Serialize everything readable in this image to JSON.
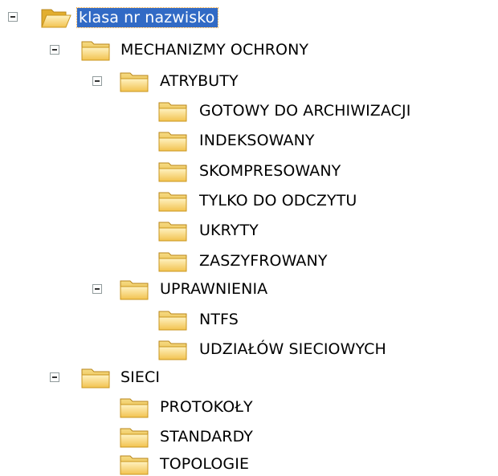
{
  "tree": {
    "root": {
      "label": "klasa nr nazwisko",
      "icon": "folder-open-icon",
      "expanded": true,
      "selected": true
    },
    "mechanizmy": {
      "label": "MECHANIZMY OCHRONY",
      "icon": "folder-open-icon",
      "expanded": true
    },
    "atrybuty": {
      "label": "ATRYBUTY",
      "icon": "folder-open-icon",
      "expanded": true
    },
    "atrybuty_children": [
      {
        "label": "GOTOWY DO ARCHIWIZACJI",
        "icon": "folder-closed-icon"
      },
      {
        "label": "INDEKSOWANY",
        "icon": "folder-closed-icon"
      },
      {
        "label": "SKOMPRESOWANY",
        "icon": "folder-closed-icon"
      },
      {
        "label": "TYLKO DO ODCZYTU",
        "icon": "folder-closed-icon"
      },
      {
        "label": "UKRYTY",
        "icon": "folder-closed-icon"
      },
      {
        "label": "ZASZYFROWANY",
        "icon": "folder-closed-icon"
      }
    ],
    "uprawnienia": {
      "label": "UPRAWNIENIA",
      "icon": "folder-open-icon",
      "expanded": true
    },
    "uprawnienia_children": [
      {
        "label": "NTFS",
        "icon": "folder-closed-icon"
      },
      {
        "label": "UDZIAŁÓW SIECIOWYCH",
        "icon": "folder-closed-icon"
      }
    ],
    "sieci": {
      "label": "SIECI",
      "icon": "folder-open-icon",
      "expanded": true
    },
    "sieci_children": [
      {
        "label": "PROTOKOŁY",
        "icon": "folder-closed-icon"
      },
      {
        "label": "STANDARDY",
        "icon": "folder-closed-icon"
      },
      {
        "label": "TOPOLOGIE",
        "icon": "folder-closed-icon"
      }
    ]
  },
  "colors": {
    "selection": "#316ac5",
    "folder_fill": "#f6d36b",
    "folder_dark": "#d8a21d",
    "expander_border": "#919b9c"
  }
}
